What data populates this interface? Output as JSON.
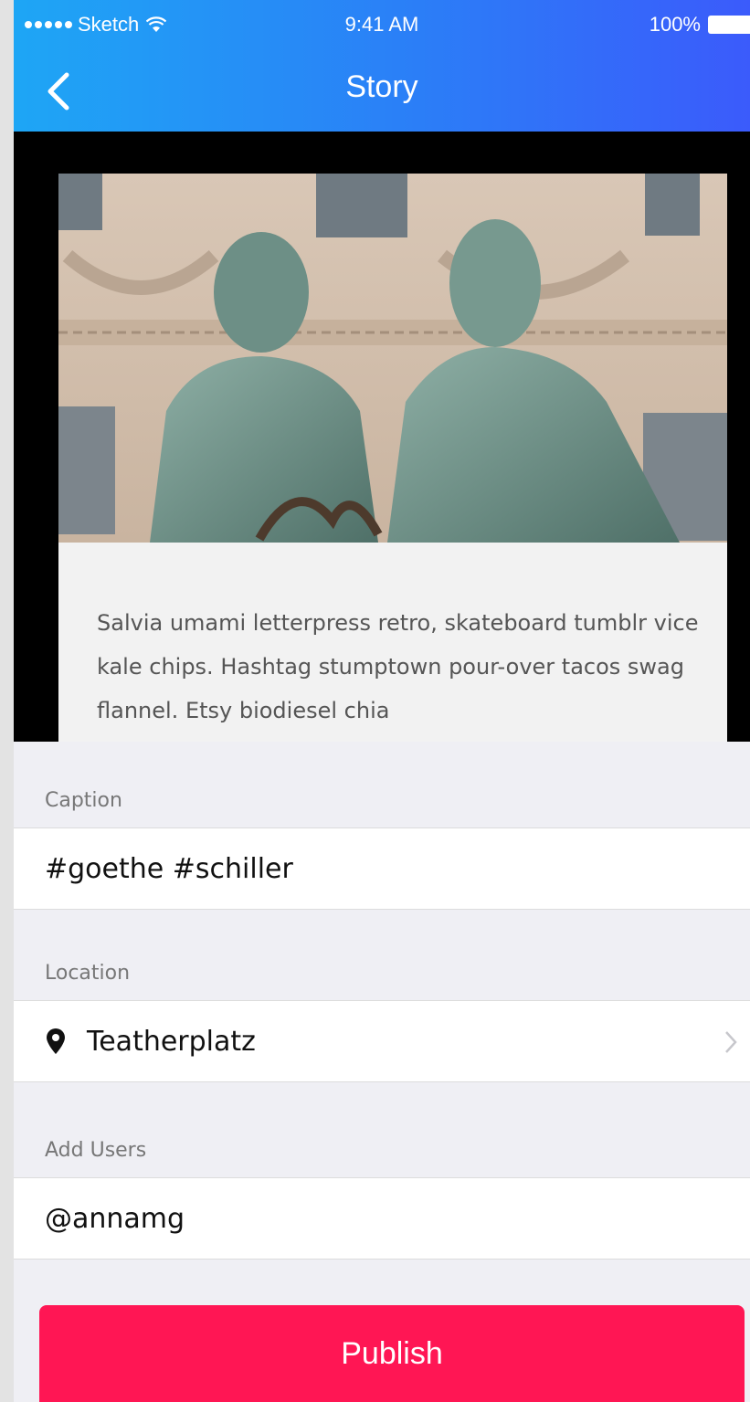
{
  "status_bar": {
    "carrier": "Sketch",
    "time": "9:41 AM",
    "battery": "100%"
  },
  "nav": {
    "title": "Story",
    "back_icon": "chevron-left-icon"
  },
  "preview": {
    "excerpt": "Salvia umami letterpress retro, skateboard tumblr vice kale chips. Hashtag stumptown pour-over tacos swag flannel. Etsy biodiesel chia"
  },
  "form": {
    "caption_label": "Caption",
    "caption_value": "#goethe #schiller",
    "location_label": "Location",
    "location_value": "Teatherplatz",
    "users_label": "Add Users",
    "users_value": "@annamg"
  },
  "actions": {
    "publish_label": "Publish"
  },
  "colors": {
    "header_start": "#1ea6f5",
    "header_end": "#3b5bfb",
    "publish": "#ff1654"
  }
}
